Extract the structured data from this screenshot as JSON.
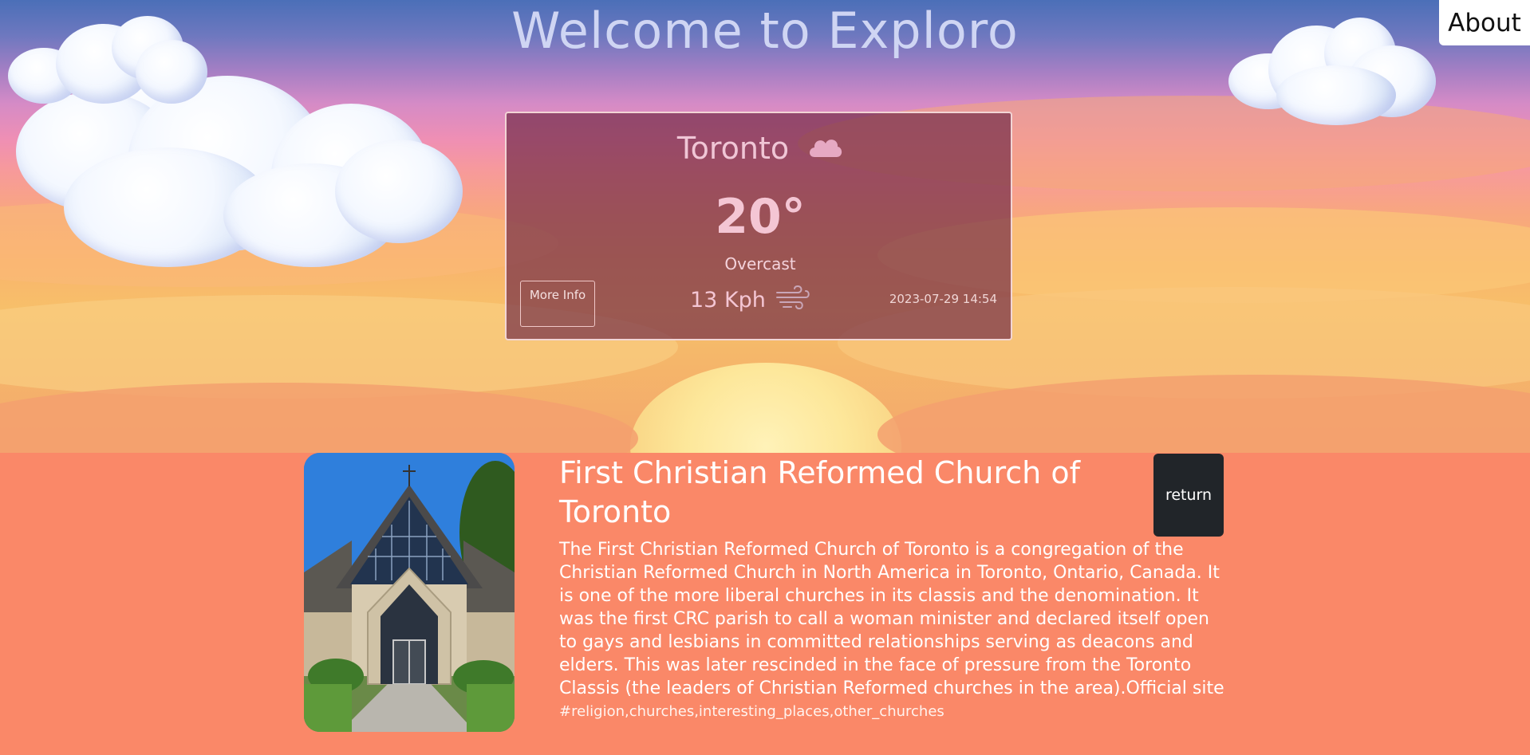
{
  "header": {
    "title": "Welcome to Exploro",
    "about_label": "About"
  },
  "weather": {
    "city": "Toronto",
    "condition_icon": "cloud-icon",
    "temperature": "20°",
    "condition": "Overcast",
    "more_info_label": "More Info",
    "wind": "13 Kph",
    "wind_icon": "wind-icon",
    "datetime": "2023-07-29 14:54"
  },
  "place": {
    "name": "First Christian Reformed Church of Toronto",
    "description": "The First Christian Reformed Church of Toronto is a congregation of the Christian Reformed Church in North America in Toronto, Ontario, Canada. It is one of the more liberal churches in its classis and the denomination. It was the first CRC parish to call a woman minister and declared itself open to gays and lesbians in committed relationships serving as deacons and elders. This was later rescinded in the face of pressure from the Toronto Classis (the leaders of Christian Reformed churches in the area).Official site",
    "tags": "#religion,churches,interesting_places,other_churches",
    "return_label": "return"
  },
  "colors": {
    "page_background": "#fa8868",
    "weather_card": "#6e2846",
    "return_button": "#212529"
  }
}
